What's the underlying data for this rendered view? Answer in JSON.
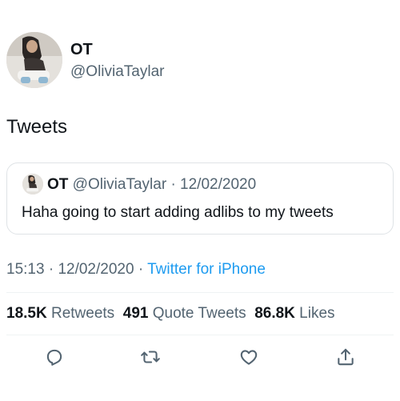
{
  "author": {
    "display_name": "OT",
    "handle": "@OliviaTaylar"
  },
  "tweet": {
    "text": "Tweets"
  },
  "quoted": {
    "display_name": "OT",
    "handle": "@OliviaTaylar",
    "separator": "·",
    "date": "12/02/2020",
    "text": "Haha going to start adding adlibs to my tweets"
  },
  "meta": {
    "time": "15:13",
    "sep1": "·",
    "date": "12/02/2020",
    "sep2": "·",
    "source": "Twitter for iPhone"
  },
  "stats": {
    "retweets_count": "18.5K",
    "retweets_label": "Retweets",
    "quotes_count": "491",
    "quotes_label": "Quote Tweets",
    "likes_count": "86.8K",
    "likes_label": "Likes"
  },
  "actions": {
    "reply_icon": "reply-icon",
    "retweet_icon": "retweet-icon",
    "like_icon": "heart-icon",
    "share_icon": "share-icon"
  },
  "colors": {
    "text": "#0f1419",
    "secondary": "#536471",
    "link": "#1d9bf0",
    "border": "#dfe3e6"
  }
}
